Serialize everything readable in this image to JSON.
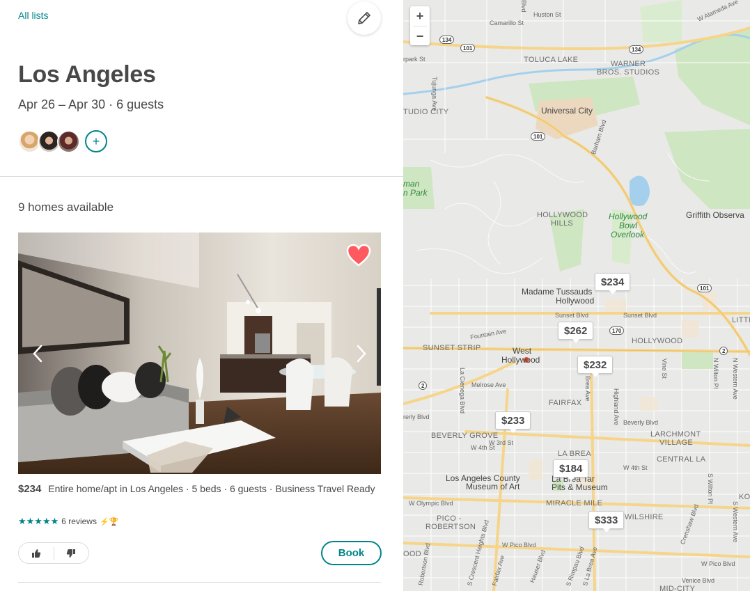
{
  "header": {
    "back_link": "All lists",
    "edit_icon": "pencil-icon"
  },
  "trip": {
    "title": "Los Angeles",
    "subtitle": "Apr 26 – Apr 30 · 6 guests",
    "add_guest_label": "+"
  },
  "listings": {
    "count_label": "9 homes available",
    "items": [
      {
        "price": "$234",
        "description": "Entire home/apt in Los Angeles · 5 beds · 6 guests · Business Travel Ready",
        "stars": "★★★★★",
        "reviews": "6 reviews",
        "badges": "⚡🏆",
        "book_label": "Book",
        "saved": true
      }
    ]
  },
  "map": {
    "zoom_in": "+",
    "zoom_out": "−",
    "pins": [
      "$234",
      "$262",
      "$232",
      "$233",
      "$184",
      "$333"
    ],
    "labels": {
      "toluca_lake": "TOLUCA LAKE",
      "warner1": "WARNER",
      "warner2": "BROS. STUDIOS",
      "studio_city": "TUDIO CITY",
      "universal": "Universal City",
      "hollywood_hills1": "HOLLYWOOD",
      "hollywood_hills2": "HILLS",
      "bowl1": "Hollywood",
      "bowl2": "Bowl",
      "bowl3": "Overlook",
      "griffith": "Griffith Observa",
      "tussauds1": "Madame Tussauds",
      "tussauds2": "Hollywood",
      "hollywood": "HOLLYWOOD",
      "sunset_strip": "SUNSET STRIP",
      "west_hollywood1": "West",
      "west_hollywood2": "Hollywood",
      "fairfax": "FAIRFAX",
      "beverly_grove": "BEVERLY GROVE",
      "la_brea": "LA BREA",
      "larchmont1": "LARCHMONT",
      "larchmont2": "VILLAGE",
      "central_la": "CENTRAL LA",
      "lacma1": "Los Angeles County",
      "lacma2": "Museum of Art",
      "tarpits1": "La Brea Tar",
      "tarpits2": "Pits & Museum",
      "miracle_mile": "MIRACLE MILE",
      "pico1": "PICO -",
      "pico2": "ROBERTSON",
      "wilshire": "WILSHIRE",
      "park1": "man",
      "park2": "n Park",
      "litt": "LITTI",
      "ko": "KO",
      "mid_city": "MID-CITY",
      "ood": "OOD",
      "huston": "Huston St",
      "camarillo": "Camarillo St",
      "alameda": "W Alameda Ave",
      "rpark": "rpark St",
      "tujunga": "Tujunga Ave",
      "barham": "Barham Blvd",
      "sunset_blvd": "Sunset Blvd",
      "sunset_blvd2": "Sunset Blvd",
      "fountain": "Fountain Ave",
      "melrose": "Melrose Ave",
      "beverly_blvd": "Beverly Blvd",
      "beverly_blvd2": "rerly Blvd",
      "w3rd": "W 3rd St",
      "w4th": "W 4th St",
      "w4th2": "W 4th St",
      "olympic": "W Olympic Blvd",
      "pico_blvd": "W Pico Blvd",
      "pico_blvd2": "W Pico Blvd",
      "venice": "Venice Blvd",
      "la_cienega": "La Cienega Blvd",
      "highland": "Highland Ave",
      "vine": "Vine St",
      "wilton": "N Wilton Pl",
      "western": "N Western Ave",
      "western2": "S Western Ave",
      "crenshaw": "Crenshaw Blvd",
      "robertson": "Robertson Blvd",
      "hauser": "Hauser Blvd",
      "crescent": "S Crescent Heights Blvd",
      "brea_ave": "Brea Ave",
      "s_la_brea": "S La Brea Ave",
      "fairfax_ave": "Fairfax Ave",
      "blvd": "Blvd",
      "rimpau": "S Rimpau Blvd",
      "wilton_s": "S Wilton Pl"
    },
    "shields": [
      "134",
      "101",
      "134",
      "101",
      "170",
      "101",
      "2",
      "2"
    ]
  }
}
